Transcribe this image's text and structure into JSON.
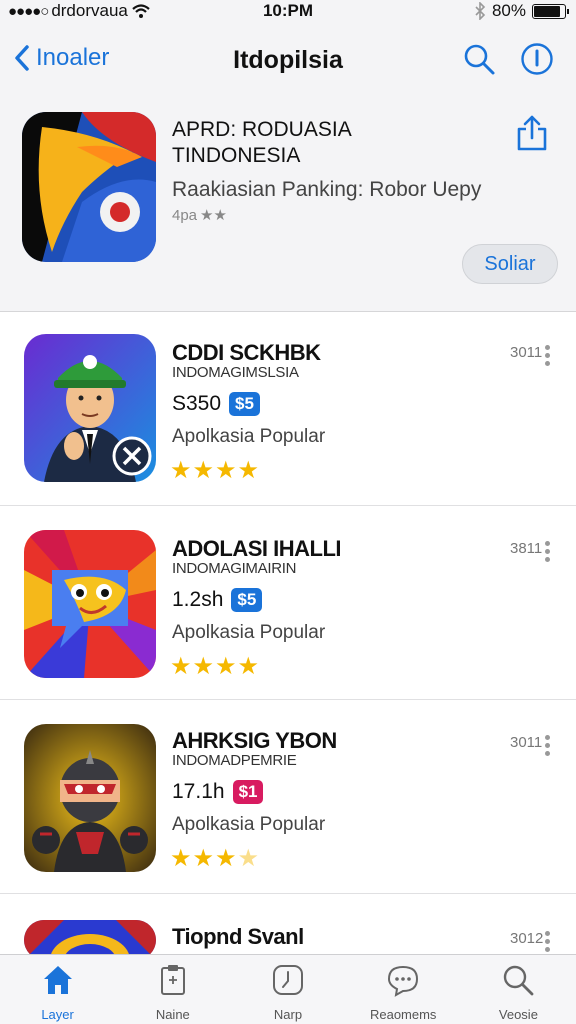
{
  "status_bar": {
    "carrier": "drdorvaua",
    "time": "10:PM",
    "battery": "80%",
    "battery_level": 0.8
  },
  "nav": {
    "back_label": "Inoaler",
    "title": "Itdopilsia"
  },
  "featured": {
    "title_line1": "APRD: RODUASIA",
    "title_line2": "TINDONESIA",
    "subtitle": "Raakiasian Panking: Robor Uepy",
    "rating_text": "4pa ★★",
    "get_label": "Soliar"
  },
  "apps": [
    {
      "name": "CDDI SCKHBK",
      "developer": "INDOMAGIMSLSIA",
      "size": "S350",
      "badge": "$5",
      "badge_color": "#1a73d9",
      "category": "Apolkasia Popular",
      "stars": 4,
      "number": "3011"
    },
    {
      "name": "ADOLASI IHALLI",
      "developer": "INDOMAGIMAIRIN",
      "size": "1.2sh",
      "badge": "$5",
      "badge_color": "#1a73d9",
      "category": "Apolkasia Popular",
      "stars": 4,
      "number": "3811"
    },
    {
      "name": "AHRKSIG YBON",
      "developer": "INDOMADPEMRIE",
      "size": "17.1h",
      "badge": "$1",
      "badge_color": "#d81b60",
      "category": "Apolkasia Popular",
      "stars": 3.5,
      "number": "3011"
    },
    {
      "name": "Tiopnd Svanl",
      "number": "3012"
    }
  ],
  "tabs": [
    {
      "label": "Layer",
      "icon": "home-icon",
      "active": true
    },
    {
      "label": "Naine",
      "icon": "document-icon",
      "active": false
    },
    {
      "label": "Narp",
      "icon": "clock-icon",
      "active": false
    },
    {
      "label": "Reaomems",
      "icon": "chat-icon",
      "active": false
    },
    {
      "label": "Veosie",
      "icon": "search-icon",
      "active": false
    }
  ],
  "colors": {
    "accent": "#1a73d9",
    "star": "#f5b800"
  }
}
